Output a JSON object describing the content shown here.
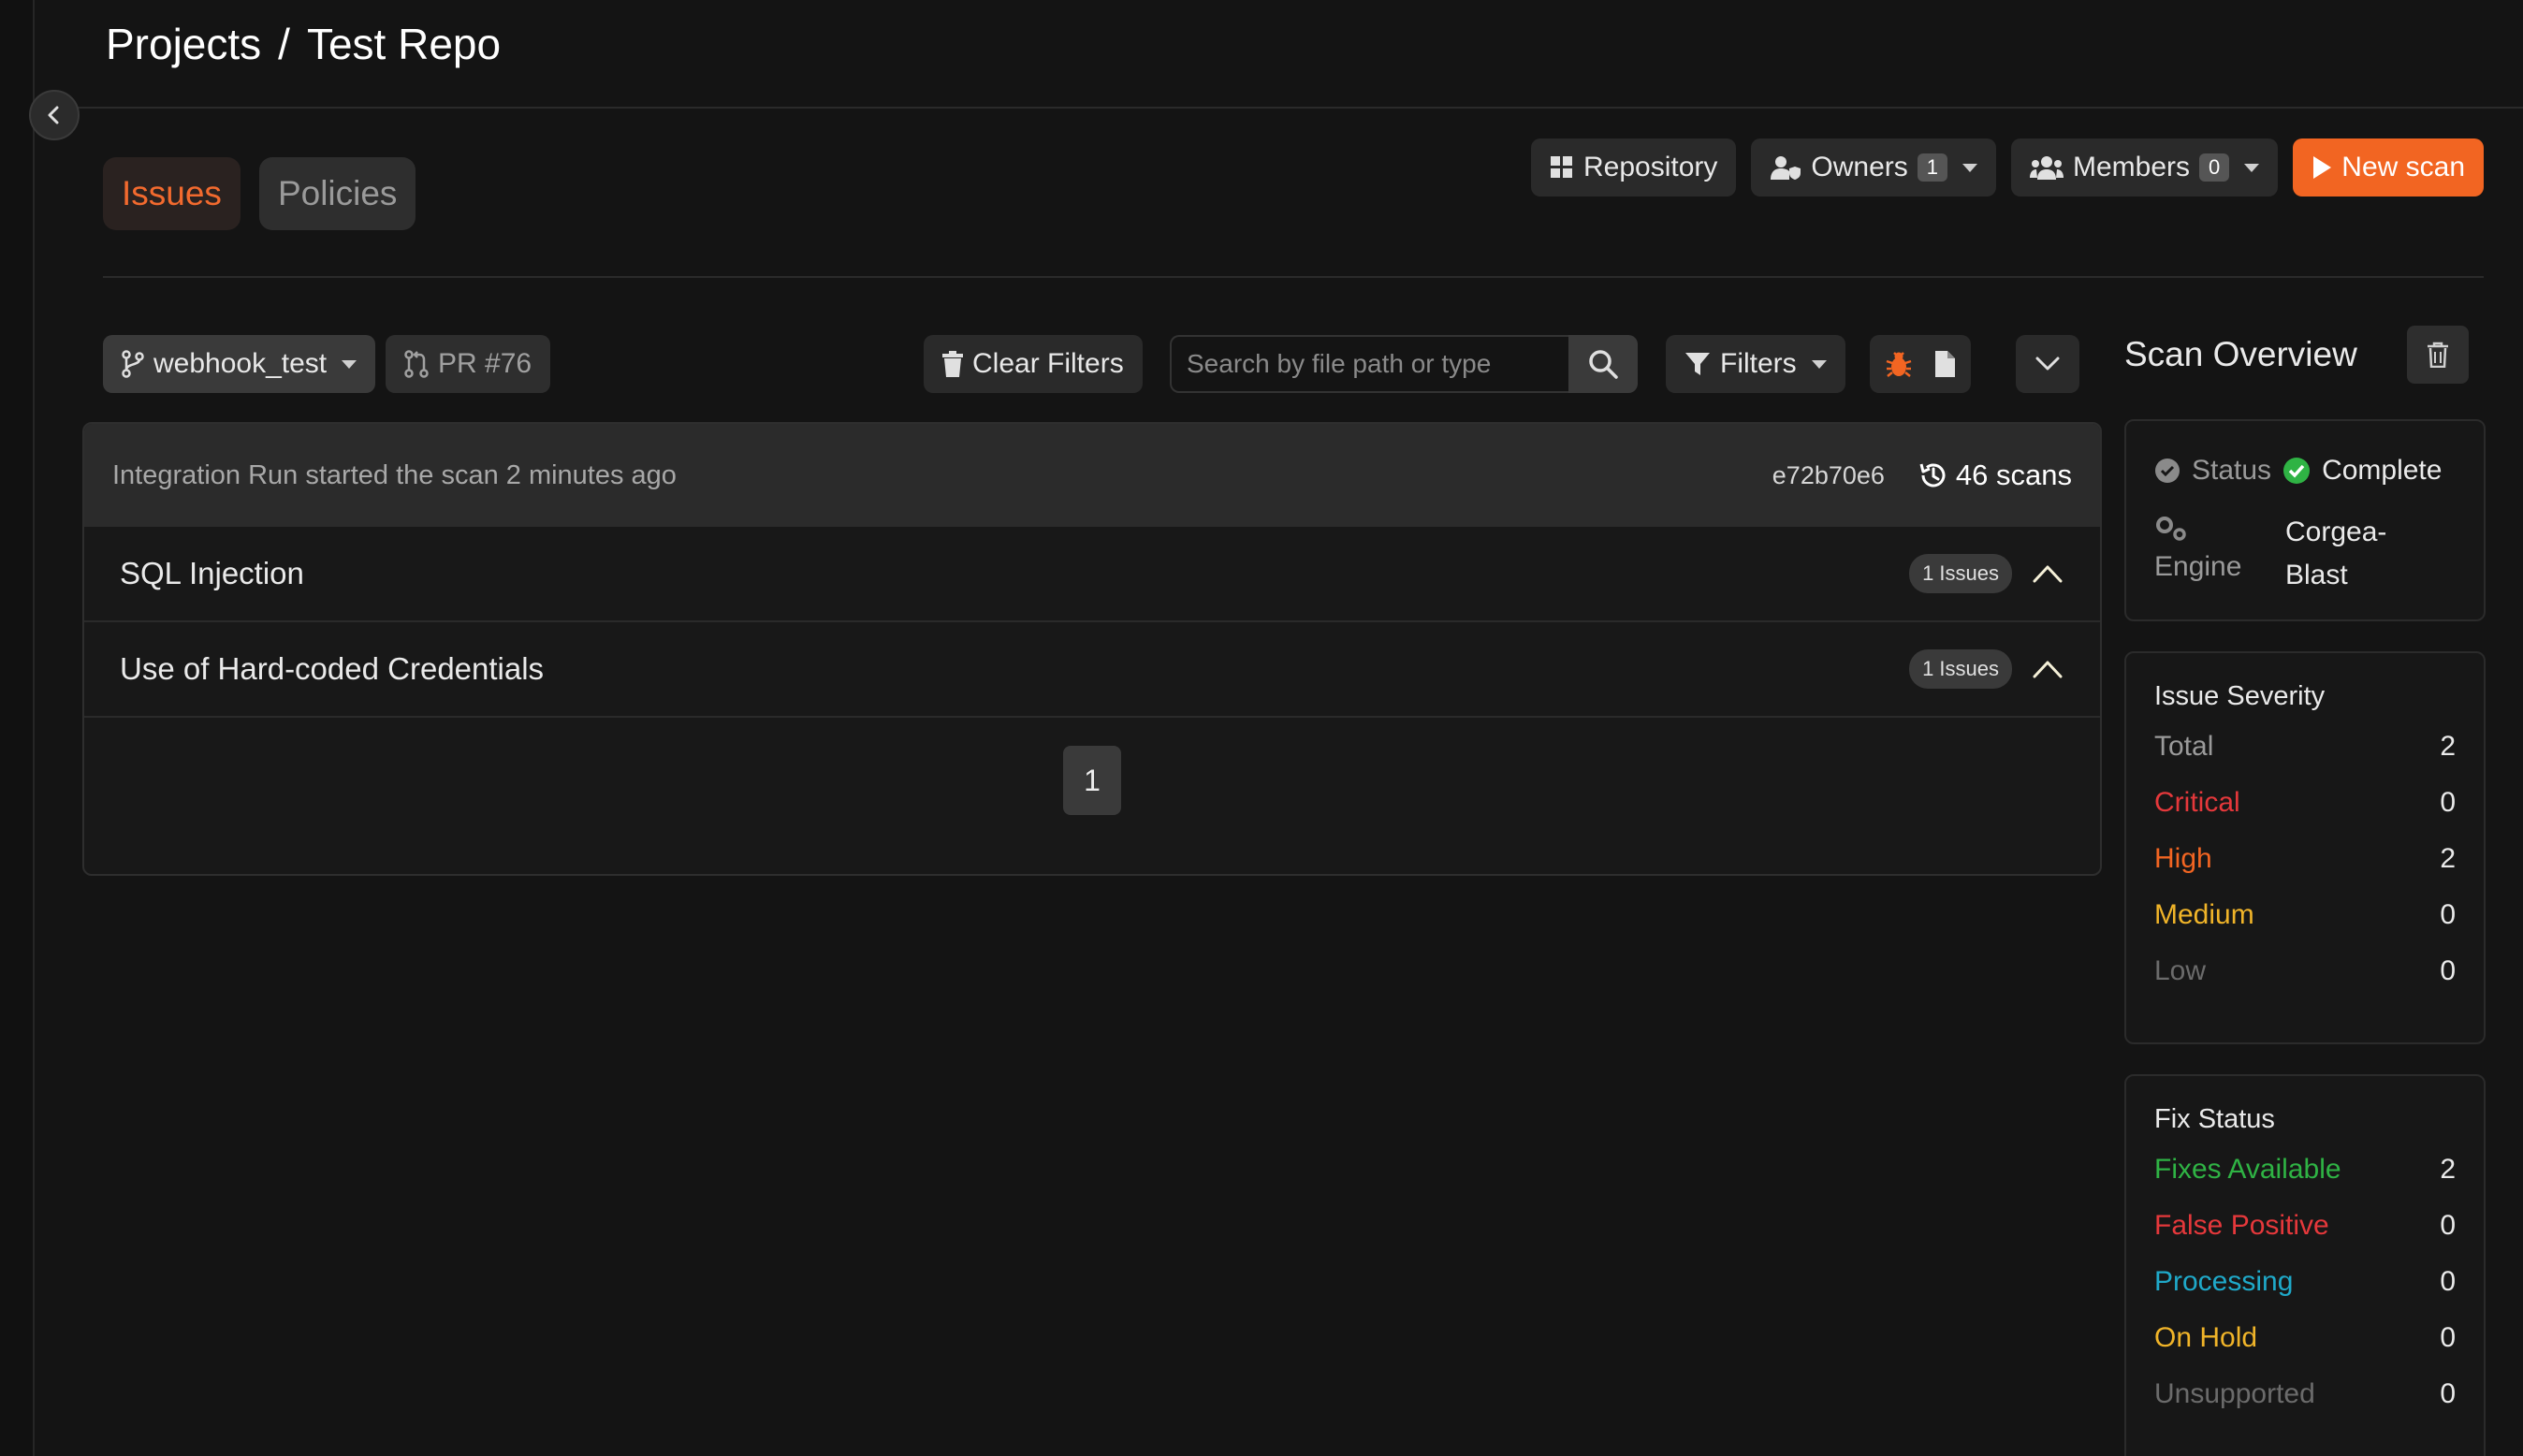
{
  "breadcrumb": {
    "root": "Projects",
    "separator": "/",
    "current": "Test Repo"
  },
  "tabs": [
    {
      "label": "Issues",
      "active": true
    },
    {
      "label": "Policies",
      "active": false
    }
  ],
  "actions": {
    "repository": "Repository",
    "owners": {
      "label": "Owners",
      "count": "1"
    },
    "members": {
      "label": "Members",
      "count": "0"
    },
    "new_scan": "New scan"
  },
  "toolbar": {
    "branch": "webhook_test",
    "pr": "PR #76",
    "clear_filters": "Clear Filters",
    "search_placeholder": "Search by file path or type",
    "filters": "Filters"
  },
  "scan": {
    "info": "Integration Run started the scan 2 minutes ago",
    "commit": "e72b70e6",
    "scans_count": "46 scans"
  },
  "issues": [
    {
      "title": "SQL Injection",
      "badge": "1 Issues"
    },
    {
      "title": "Use of Hard-coded Credentials",
      "badge": "1 Issues"
    }
  ],
  "pagination": {
    "current": "1"
  },
  "overview": {
    "title": "Scan Overview",
    "status_label": "Status",
    "status_value": "Complete",
    "engine_label": "Engine",
    "engine_value_1": "Corgea-",
    "engine_value_2": "Blast"
  },
  "severity": {
    "title": "Issue Severity",
    "rows": [
      {
        "label": "Total",
        "value": "2",
        "color": "#9a9a9a"
      },
      {
        "label": "Critical",
        "value": "0",
        "color": "#e5383b"
      },
      {
        "label": "High",
        "value": "2",
        "color": "#f26522"
      },
      {
        "label": "Medium",
        "value": "0",
        "color": "#f0b429"
      },
      {
        "label": "Low",
        "value": "0",
        "color": "#6b6b6b"
      }
    ]
  },
  "fix_status": {
    "title": "Fix Status",
    "rows": [
      {
        "label": "Fixes Available",
        "value": "2",
        "color": "#2fb344"
      },
      {
        "label": "False Positive",
        "value": "0",
        "color": "#e5383b"
      },
      {
        "label": "Processing",
        "value": "0",
        "color": "#1fa9c9"
      },
      {
        "label": "On Hold",
        "value": "0",
        "color": "#f0b429"
      },
      {
        "label": "Unsupported",
        "value": "0",
        "color": "#6b6b6b"
      }
    ]
  },
  "colors": {
    "accent": "#f26522",
    "complete": "#2fb344"
  }
}
